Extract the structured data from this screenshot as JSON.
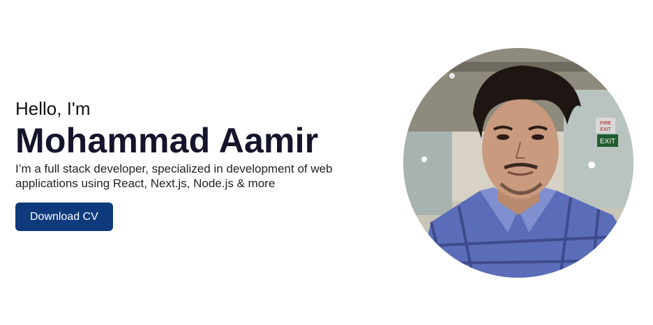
{
  "hero": {
    "greeting": "Hello, I'm",
    "name": "Mohammad Aamir",
    "tagline": "I’m a full stack developer, specialized in development of web applications using React, Next.js, Node.js & more",
    "cta_label": "Download CV"
  },
  "avatar": {
    "sign_fire": "FIRE",
    "sign_exit": "EXIT",
    "sign_exit2": "EXIT"
  },
  "colors": {
    "accent": "#0e3a7c",
    "heading": "#14142b"
  }
}
